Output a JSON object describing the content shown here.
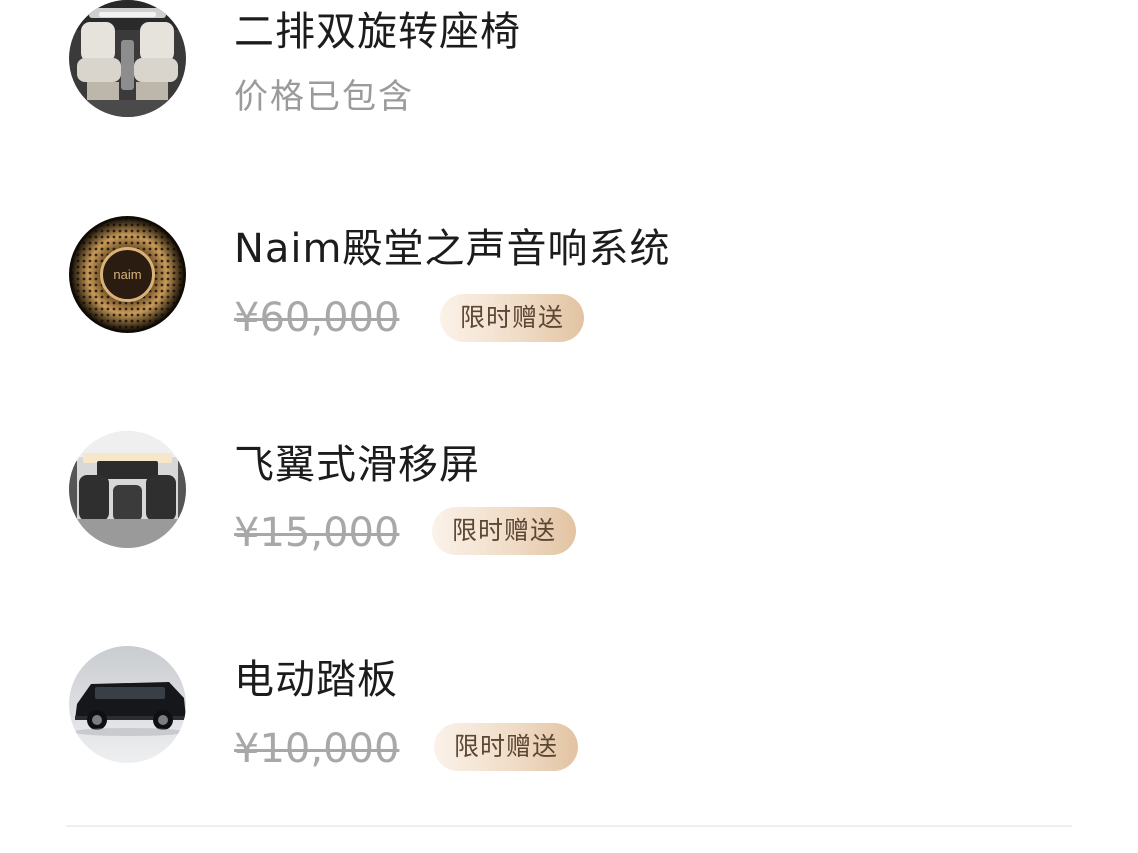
{
  "features": [
    {
      "title": "二排双旋转座椅",
      "note": "价格已包含",
      "image": "rotating-seats-photo"
    },
    {
      "title": "Naim殿堂之声音响系统",
      "original_price": "¥60,000",
      "badge": "限时赠送",
      "image": "naim-speaker-photo",
      "logo_text": "naim"
    },
    {
      "title": "飞翼式滑移屏",
      "original_price": "¥15,000",
      "badge": "限时赠送",
      "image": "sliding-screen-cabin-photo"
    },
    {
      "title": "电动踏板",
      "original_price": "¥10,000",
      "badge": "限时赠送",
      "image": "suv-side-view-photo"
    }
  ],
  "colors": {
    "title": "#1c1c1c",
    "note": "#9b9b9b",
    "strikethrough_price": "#a8a8a8",
    "badge_text": "#5c4634",
    "badge_gradient_start": "#fbf2e9",
    "badge_gradient_end": "#e2c3a2"
  }
}
